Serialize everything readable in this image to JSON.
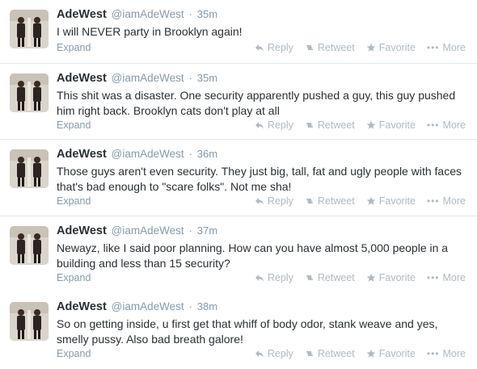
{
  "actions": {
    "expand": "Expand",
    "reply": "Reply",
    "retweet": "Retweet",
    "favorite": "Favorite",
    "more": "More"
  },
  "icons": {
    "reply": "reply-arrow-icon",
    "retweet": "retweet-icon",
    "favorite": "star-icon",
    "more": "ellipsis-icon"
  },
  "colors": {
    "name": "#292f33",
    "meta": "#8899a6",
    "action": "#b0bac2",
    "divider": "#e1e8ed"
  },
  "tweets": [
    {
      "fullname": "AdeWest",
      "username": "@iamAdeWest",
      "sep": "·",
      "time": "35m",
      "text": "I will NEVER party in Brooklyn again!"
    },
    {
      "fullname": "AdeWest",
      "username": "@iamAdeWest",
      "sep": "·",
      "time": "35m",
      "text": "This shit was a disaster. One security apparently pushed a guy, this guy pushed him right back. Brooklyn cats don't play at all"
    },
    {
      "fullname": "AdeWest",
      "username": "@iamAdeWest",
      "sep": "·",
      "time": "36m",
      "text": "Those guys aren't even security. They just big, tall, fat and ugly people with faces that's bad enough to \"scare folks\". Not me sha!"
    },
    {
      "fullname": "AdeWest",
      "username": "@iamAdeWest",
      "sep": "·",
      "time": "37m",
      "text": "Newayz, like I said poor planning. How can you have almost 5,000 people in a building and less than 15 security?"
    },
    {
      "fullname": "AdeWest",
      "username": "@iamAdeWest",
      "sep": "·",
      "time": "38m",
      "text": "So on getting inside, u first get that whiff of body odor, stank weave and yes, smelly pussy. Also bad breath galore!"
    }
  ]
}
